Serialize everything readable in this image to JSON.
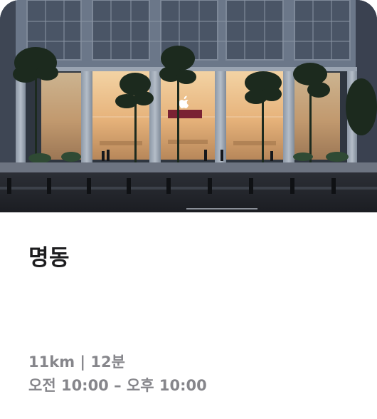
{
  "store": {
    "name": "명동",
    "distance_time": "11km | 12분",
    "hours": "오전 10:00 – 오후 10:00"
  },
  "colors": {
    "title": "#1d1d1f",
    "meta": "#86868b",
    "card_background": "#ffffff"
  },
  "icons": {
    "storefront_logo": "apple-logo-icon"
  }
}
